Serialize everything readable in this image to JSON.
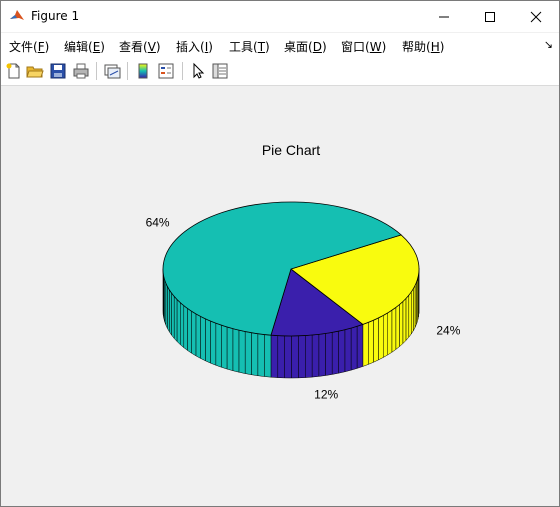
{
  "window": {
    "title": "Figure 1"
  },
  "menu": {
    "items": [
      {
        "label": "文件",
        "accel": "F"
      },
      {
        "label": "编辑",
        "accel": "E"
      },
      {
        "label": "查看",
        "accel": "V"
      },
      {
        "label": "插入",
        "accel": "I"
      },
      {
        "label": "工具",
        "accel": "T"
      },
      {
        "label": "桌面",
        "accel": "D"
      },
      {
        "label": "窗口",
        "accel": "W"
      },
      {
        "label": "帮助",
        "accel": "H"
      }
    ],
    "overflow": "↘"
  },
  "toolbar": {
    "icons": [
      "new-file-icon",
      "open-folder-icon",
      "save-icon",
      "print-icon",
      "link-plot-icon",
      "insert-colorbar-icon",
      "insert-legend-icon",
      "pointer-icon",
      "property-inspector-icon"
    ]
  },
  "chart_data": {
    "type": "pie",
    "title": "Pie Chart",
    "style": "3d",
    "slices": [
      {
        "value": 12,
        "label": "12%",
        "color": "#3a1fac"
      },
      {
        "value": 24,
        "label": "24%",
        "color": "#f9fb0e"
      },
      {
        "value": 64,
        "label": "64%",
        "color": "#15bfb2"
      }
    ]
  }
}
